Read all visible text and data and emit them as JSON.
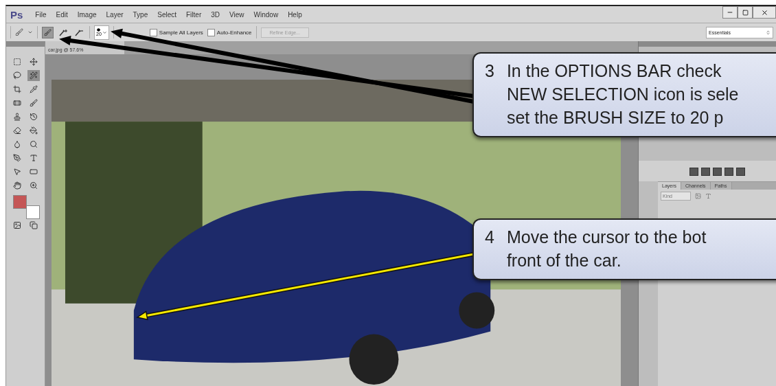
{
  "app": {
    "logo": "Ps",
    "menu": [
      "File",
      "Edit",
      "Image",
      "Layer",
      "Type",
      "Select",
      "Filter",
      "3D",
      "View",
      "Window",
      "Help"
    ]
  },
  "options_bar": {
    "modes": [
      {
        "kind": "new",
        "selected": true
      },
      {
        "kind": "add",
        "selected": false
      },
      {
        "kind": "subtract",
        "selected": false
      }
    ],
    "brush_size": "20",
    "checkboxes": [
      {
        "label": "Sample All Layers",
        "checked": false
      },
      {
        "label": "Auto-Enhance",
        "checked": false
      }
    ],
    "refine_edge": {
      "label": "Refine Edge...",
      "disabled": true
    },
    "workspace": "Essentials"
  },
  "document": {
    "tab": "car.jpg @ 57.6%"
  },
  "tools": [
    {
      "kind": "marquee",
      "selected": false
    },
    {
      "kind": "move",
      "selected": false
    },
    {
      "kind": "lasso",
      "selected": false
    },
    {
      "kind": "quick-selection",
      "selected": true
    },
    {
      "kind": "crop",
      "selected": false
    },
    {
      "kind": "eyedropper",
      "selected": false
    },
    {
      "kind": "healing",
      "selected": false
    },
    {
      "kind": "brush",
      "selected": false
    },
    {
      "kind": "stamp",
      "selected": false
    },
    {
      "kind": "history",
      "selected": false
    },
    {
      "kind": "eraser",
      "selected": false
    },
    {
      "kind": "bucket",
      "selected": false
    },
    {
      "kind": "blur",
      "selected": false
    },
    {
      "kind": "dodge",
      "selected": false
    },
    {
      "kind": "pen",
      "selected": false
    },
    {
      "kind": "type",
      "selected": false
    },
    {
      "kind": "path",
      "selected": false
    },
    {
      "kind": "shape",
      "selected": false
    },
    {
      "kind": "hand",
      "selected": false
    },
    {
      "kind": "zoom",
      "selected": false
    }
  ],
  "swatches": [
    {
      "kind": "foreground",
      "color": "#c45656"
    },
    {
      "kind": "background",
      "color": "#ffffff"
    }
  ],
  "layers_panel": {
    "tabs": [
      {
        "label": "Layers",
        "selected": true
      },
      {
        "label": "Channels",
        "selected": false
      },
      {
        "label": "Paths",
        "selected": false
      }
    ],
    "filter": "Kind"
  },
  "callouts": [
    {
      "number": "3",
      "lines": [
        "In the OPTIONS BAR check",
        "NEW SELECTION icon is sele",
        "set the BRUSH SIZE to 20 p"
      ]
    },
    {
      "number": "4",
      "lines": [
        "Move the cursor to the bot",
        "front of the car."
      ]
    }
  ]
}
